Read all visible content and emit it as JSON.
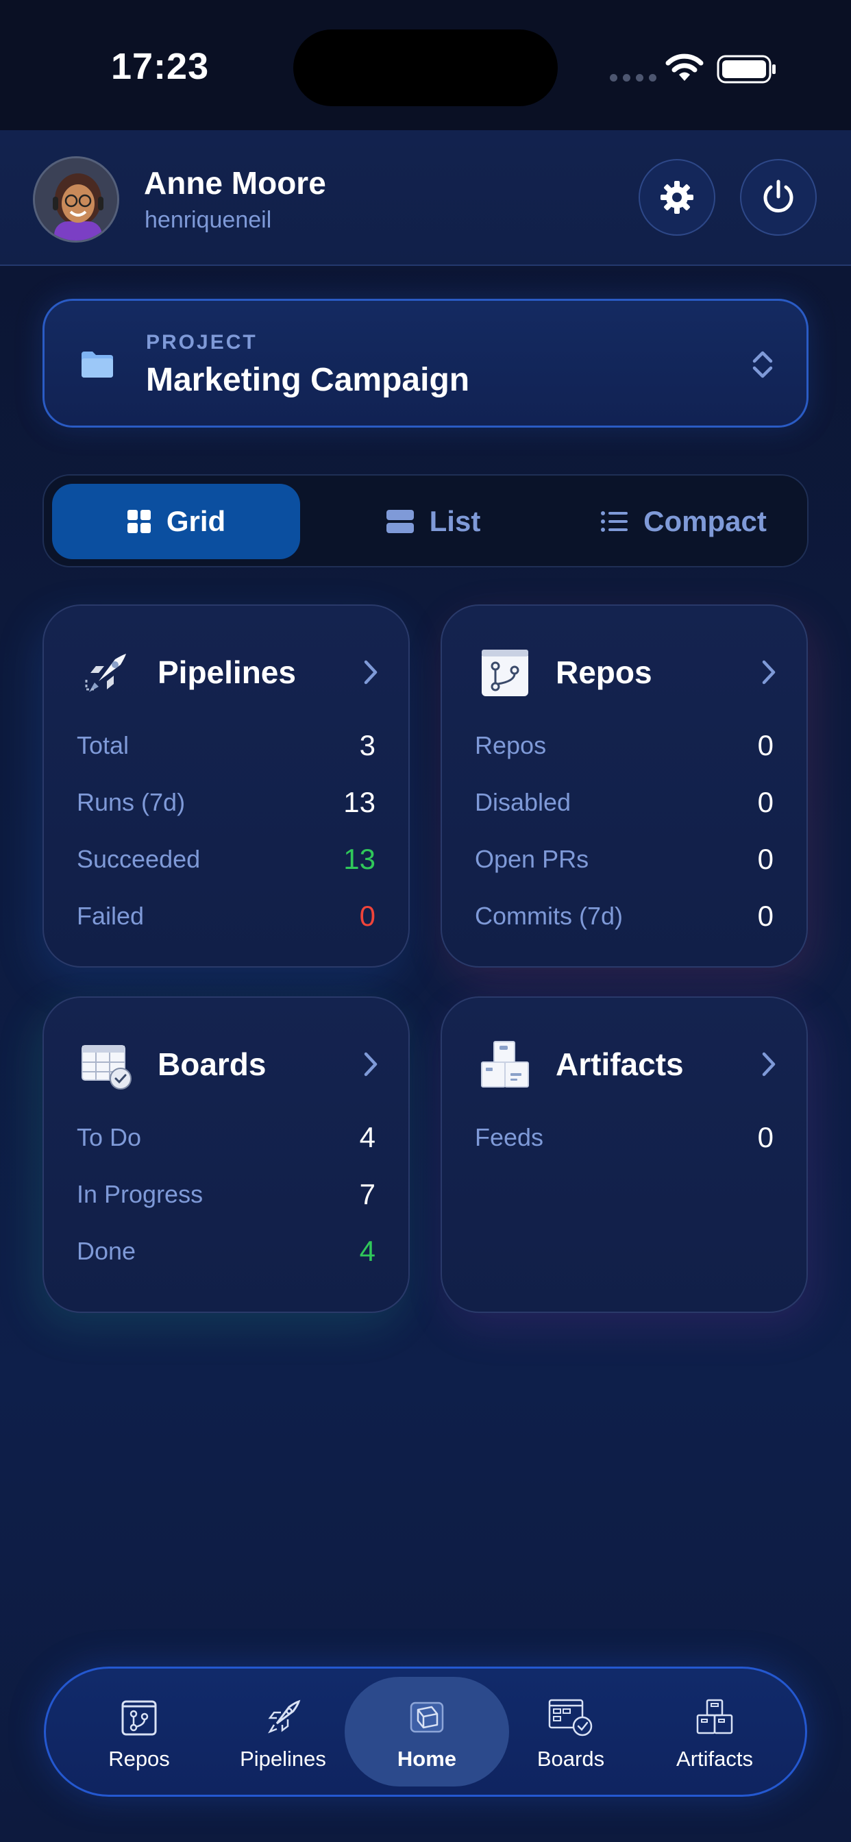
{
  "status_bar": {
    "time": "17:23"
  },
  "header": {
    "user_name": "Anne Moore",
    "username": "henriqueneil"
  },
  "project": {
    "label": "PROJECT",
    "name": "Marketing Campaign"
  },
  "view_modes": [
    {
      "label": "Grid",
      "active": true
    },
    {
      "label": "List",
      "active": false
    },
    {
      "label": "Compact",
      "active": false
    }
  ],
  "cards": {
    "pipelines": {
      "title": "Pipelines",
      "icon": "rocket-icon",
      "stats": [
        {
          "label": "Total",
          "value": "3"
        },
        {
          "label": "Runs (7d)",
          "value": "13"
        },
        {
          "label": "Succeeded",
          "value": "13"
        },
        {
          "label": "Failed",
          "value": "0"
        }
      ]
    },
    "repos": {
      "title": "Repos",
      "icon": "repo-branch-icon",
      "stats": [
        {
          "label": "Repos",
          "value": "0"
        },
        {
          "label": "Disabled",
          "value": "0"
        },
        {
          "label": "Open PRs",
          "value": "0"
        },
        {
          "label": "Commits (7d)",
          "value": "0"
        }
      ]
    },
    "boards": {
      "title": "Boards",
      "icon": "board-check-icon",
      "stats": [
        {
          "label": "To Do",
          "value": "4"
        },
        {
          "label": "In Progress",
          "value": "7"
        },
        {
          "label": "Done",
          "value": "4"
        }
      ]
    },
    "artifacts": {
      "title": "Artifacts",
      "icon": "package-boxes-icon",
      "stats": [
        {
          "label": "Feeds",
          "value": "0"
        }
      ]
    }
  },
  "tabbar": [
    {
      "label": "Repos",
      "icon": "repo-branch-icon",
      "active": false
    },
    {
      "label": "Pipelines",
      "icon": "rocket-icon",
      "active": false
    },
    {
      "label": "Home",
      "icon": "home-cube-icon",
      "active": true
    },
    {
      "label": "Boards",
      "icon": "board-check-icon",
      "active": false
    },
    {
      "label": "Artifacts",
      "icon": "package-boxes-icon",
      "active": false
    }
  ],
  "colors": {
    "accent": "#0b4fa0",
    "success": "#30c85a",
    "danger": "#f0443a",
    "muted_text": "#7f9ad8"
  }
}
